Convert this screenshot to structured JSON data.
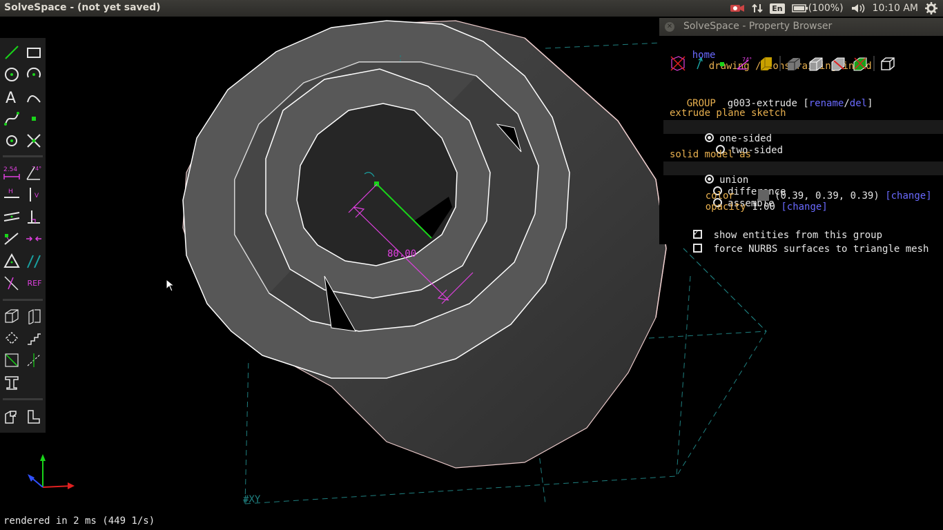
{
  "window": {
    "title": "SolveSpace - (not yet saved)"
  },
  "tray": {
    "language": "En",
    "battery": "(100%)",
    "time": "10:10 AM"
  },
  "viewport": {
    "workplane_label": "#XY",
    "dimension_label": "80.00",
    "status": "rendered in 2 ms (449 1/s)"
  },
  "toolbar": {
    "dim_label": "2.54",
    "angle_label": "74°",
    "h_label": "H",
    "v_label": "V",
    "ref_label": "REF"
  },
  "property_browser": {
    "title": "SolveSpace - Property Browser",
    "nav": {
      "home": "home",
      "breadcrumb": "drawing / constraining in 3d"
    },
    "angle_icon_label": "74°",
    "group": {
      "prefix": "GROUP",
      "name": "g003-extrude",
      "rename": "rename",
      "del": "del"
    },
    "extrude": {
      "heading": "extrude plane sketch",
      "one_sided": "one-sided",
      "two_sided": "two-sided"
    },
    "solid_model": {
      "heading": "solid model as",
      "union": "union",
      "difference": "difference",
      "assemble": "assemble"
    },
    "color": {
      "label": "color",
      "value": "(0.39, 0.39, 0.39)",
      "change": "change",
      "swatch": "#636363"
    },
    "opacity": {
      "label": "opacity",
      "value": "1.00",
      "change": "change"
    },
    "show_entities": "show entities from this group",
    "force_nurbs": "force NURBS surfaces to triangle mesh"
  },
  "colors": {
    "accent_green": "#19d419",
    "constraint_magenta": "#e040e0",
    "link_blue": "#6a6aff",
    "label_yellow": "#e8b04f"
  }
}
